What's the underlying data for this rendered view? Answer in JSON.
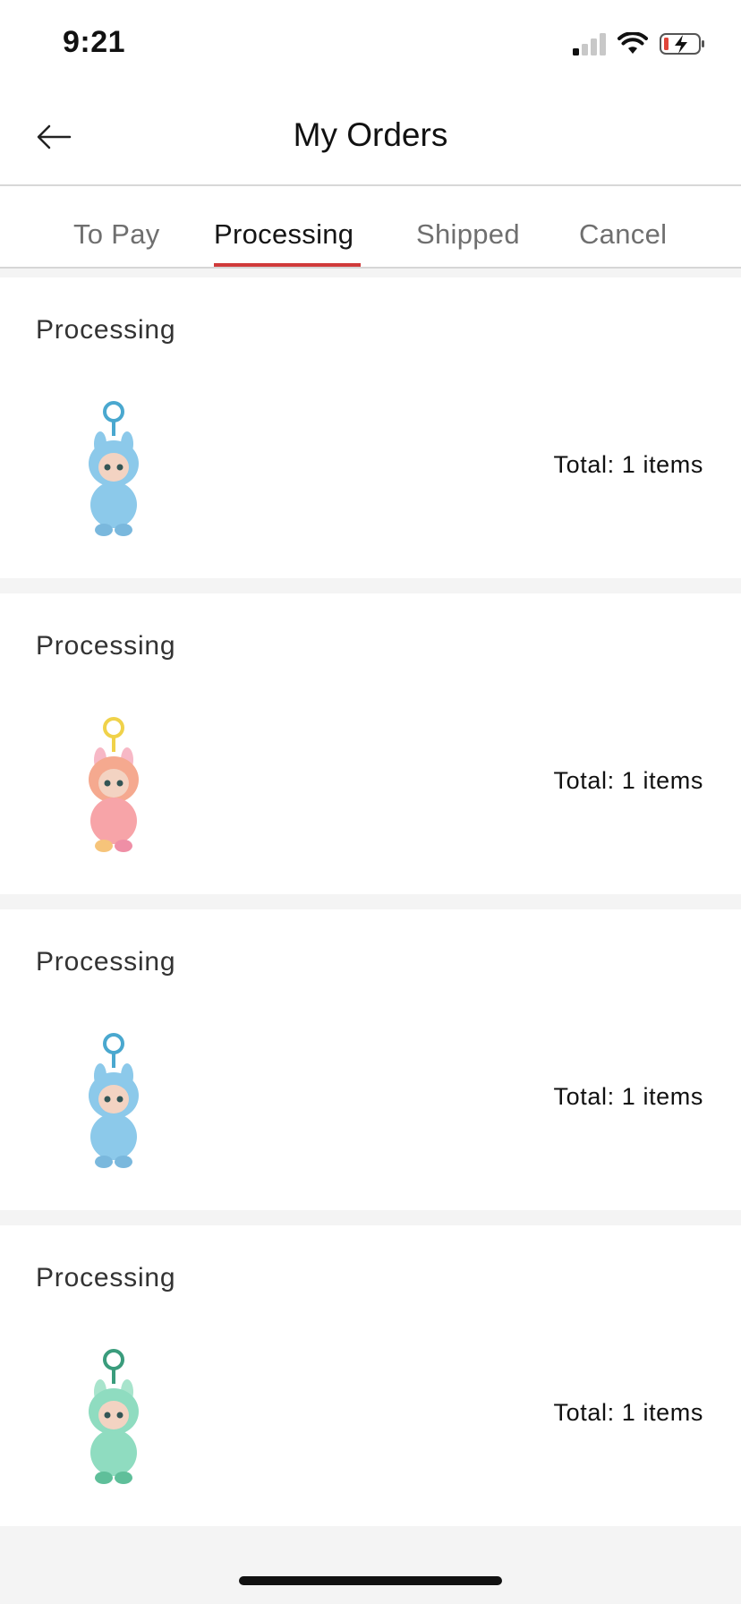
{
  "status_bar": {
    "time": "9:21",
    "icons": [
      "cellular-signal-icon",
      "wifi-icon",
      "battery-charging-icon"
    ]
  },
  "header": {
    "back_icon": "arrow-left-icon",
    "title": "My Orders"
  },
  "tabs": {
    "items": [
      {
        "label": "To Pay"
      },
      {
        "label": "Processing"
      },
      {
        "label": "Shipped"
      },
      {
        "label": "Cancel"
      }
    ],
    "active": "Processing",
    "accent_color": "#d03a3a"
  },
  "orders": [
    {
      "status": "Processing",
      "total": "Total: 1 items",
      "product_color": "#8cc9ea",
      "ring_color": "#4aa8cf"
    },
    {
      "status": "Processing",
      "total": "Total: 1 items",
      "product_color": "#f5a98f",
      "ring_color": "#f0d24a"
    },
    {
      "status": "Processing",
      "total": "Total: 1 items",
      "product_color": "#8cc9ea",
      "ring_color": "#4aa8cf"
    },
    {
      "status": "Processing",
      "total": "Total: 1 items",
      "product_color": "#8fdcc0",
      "ring_color": "#3a9c7c"
    }
  ]
}
